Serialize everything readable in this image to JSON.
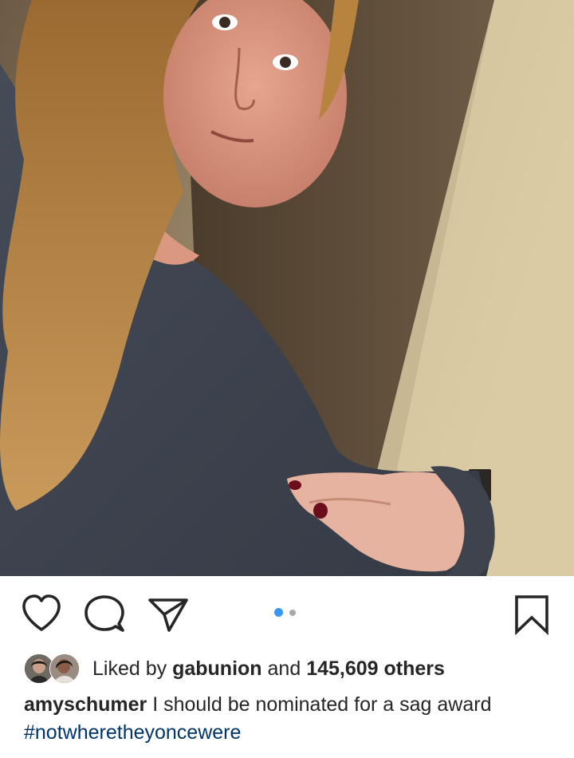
{
  "post": {
    "carousel": {
      "total": 2,
      "active": 1
    },
    "likes": {
      "prefix": "Liked by",
      "user": "gabunion",
      "connector": "and",
      "count": "145,609 others"
    },
    "caption": {
      "username": "amyschumer",
      "text": "I should be nominated for a sag award",
      "hashtag": "#notwheretheyoncewere"
    }
  },
  "colors": {
    "carousel_active": "#3897f0",
    "carousel_inactive": "#a8a8a8",
    "hashtag": "#003569",
    "text": "#262626"
  },
  "icons": {
    "like": "heart-icon",
    "comment": "comment-icon",
    "share": "paper-plane-icon",
    "save": "bookmark-icon"
  }
}
